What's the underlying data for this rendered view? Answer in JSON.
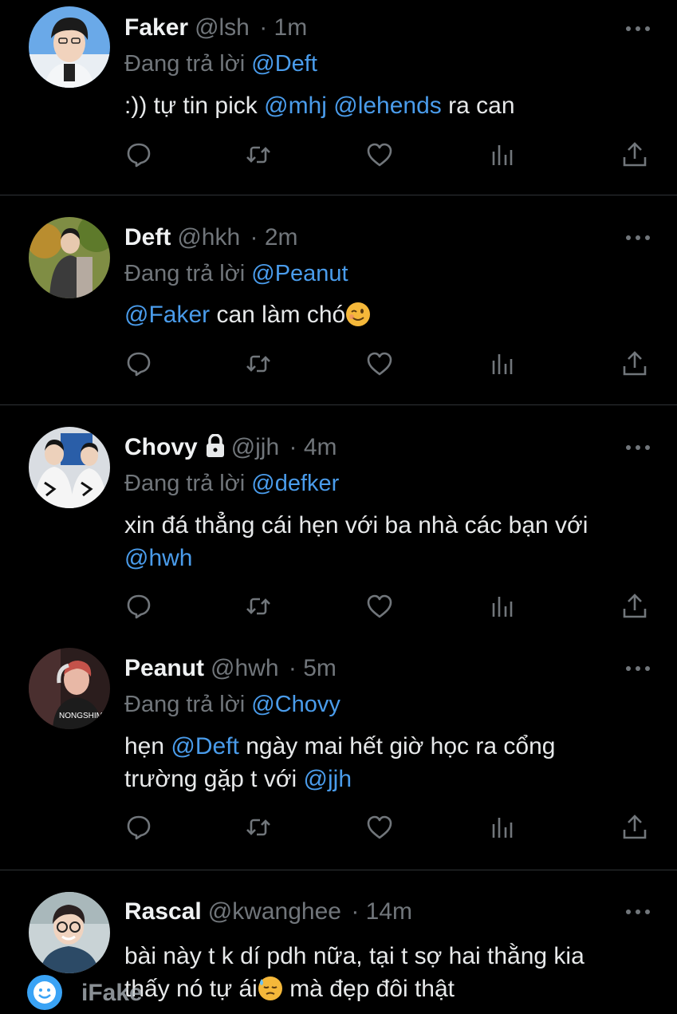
{
  "colors": {
    "background": "#000000",
    "text": "#e7e9ea",
    "muted": "#71767b",
    "link": "#4a9ceb",
    "divider": "#2f3336"
  },
  "icons": {
    "reply": "comment-bubble-icon",
    "retweet": "retweet-icon",
    "like": "heart-icon",
    "views": "bar-chart-icon",
    "share": "share-icon",
    "more": "more-dots-icon",
    "lock": "lock-icon"
  },
  "tweets": [
    {
      "name": "Faker",
      "handle": "@lsh",
      "time": "· 1m",
      "reply_prefix": "Đang trả lời",
      "reply_to": "@Deft",
      "line1": [
        {
          "t": ":)) tự tin pick ",
          "l": false
        },
        {
          "t": "@mhj",
          "l": true
        },
        {
          "t": " ",
          "l": false
        },
        {
          "t": "@lehends",
          "l": true
        },
        {
          "t": " ra can",
          "l": false
        }
      ]
    },
    {
      "name": "Deft",
      "handle": "@hkh",
      "time": "· 2m",
      "reply_prefix": "Đang trả lời",
      "reply_to": "@Peanut",
      "line1": [
        {
          "t": "@Faker",
          "l": true
        },
        {
          "t": " can làm chó",
          "l": false
        }
      ],
      "emoji": "winking-face"
    },
    {
      "name": "Chovy",
      "handle": "@jjh",
      "time": "· 4m",
      "reply_prefix": "Đang trả lời",
      "reply_to": "@defker",
      "line1": [
        {
          "t": "xin đá thẳng cái hẹn với ba nhà các bạn với",
          "l": false
        }
      ],
      "line2": [
        {
          "t": "@hwh",
          "l": true
        }
      ]
    },
    {
      "name": "Peanut",
      "handle": "@hwh",
      "time": "· 5m",
      "reply_prefix": "Đang trả lời",
      "reply_to": "@Chovy",
      "line1": [
        {
          "t": "hẹn ",
          "l": false
        },
        {
          "t": "@Deft",
          "l": true
        },
        {
          "t": " ngày mai hết giờ học ra cổng",
          "l": false
        }
      ],
      "line2": [
        {
          "t": "trường gặp t với ",
          "l": false
        },
        {
          "t": "@jjh",
          "l": true
        }
      ]
    },
    {
      "name": "Rascal",
      "handle": "@kwanghee",
      "time": "· 14m",
      "line1": [
        {
          "t": "bài này t k dí pdh nữa, tại t sợ hai thằng kia",
          "l": false
        }
      ],
      "line2": [
        {
          "t": "thấy nó tự ái",
          "l": false
        }
      ],
      "line2_after_emoji": " mà đẹp đôi thật",
      "emoji2": "downcast-face-with-sweat"
    }
  ],
  "watermark": {
    "text": "iFake"
  }
}
